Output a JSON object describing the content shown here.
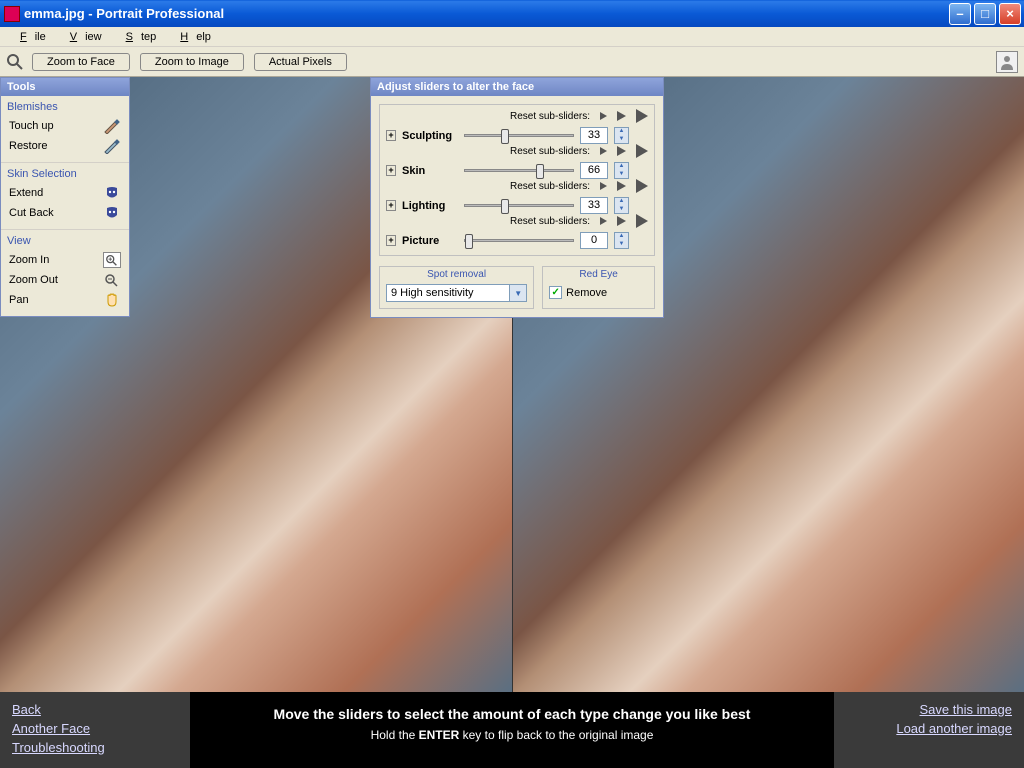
{
  "title": "emma.jpg - Portrait Professional",
  "menu": {
    "file": "File",
    "view": "View",
    "step": "Step",
    "help": "Help"
  },
  "toolbar": {
    "zoom_face": "Zoom to Face",
    "zoom_image": "Zoom to Image",
    "actual": "Actual Pixels"
  },
  "tools_panel": {
    "title": "Tools",
    "blemishes": {
      "title": "Blemishes",
      "touchup": "Touch up",
      "restore": "Restore"
    },
    "skin": {
      "title": "Skin Selection",
      "extend": "Extend",
      "cutback": "Cut Back"
    },
    "view": {
      "title": "View",
      "zoomin": "Zoom In",
      "zoomout": "Zoom Out",
      "pan": "Pan"
    }
  },
  "adjust": {
    "title": "Adjust sliders to alter the face",
    "reset_label": "Reset sub-sliders:",
    "sliders": [
      {
        "name": "Sculpting",
        "value": 33,
        "pos": 33
      },
      {
        "name": "Skin",
        "value": 66,
        "pos": 66
      },
      {
        "name": "Lighting",
        "value": 33,
        "pos": 33
      },
      {
        "name": "Picture",
        "value": 0,
        "pos": 0
      }
    ],
    "spot": {
      "title": "Spot removal",
      "value": "9 High sensitivity"
    },
    "redeye": {
      "title": "Red Eye",
      "label": "Remove",
      "checked": true
    }
  },
  "footer": {
    "left": {
      "back": "Back",
      "another": "Another Face",
      "trouble": "Troubleshooting"
    },
    "center": {
      "l1": "Move the sliders to select the amount of each type change you like best",
      "l2a": "Hold the ",
      "l2b": "ENTER",
      "l2c": " key to flip back to the original image"
    },
    "right": {
      "save": "Save this image",
      "load": "Load another image"
    }
  }
}
